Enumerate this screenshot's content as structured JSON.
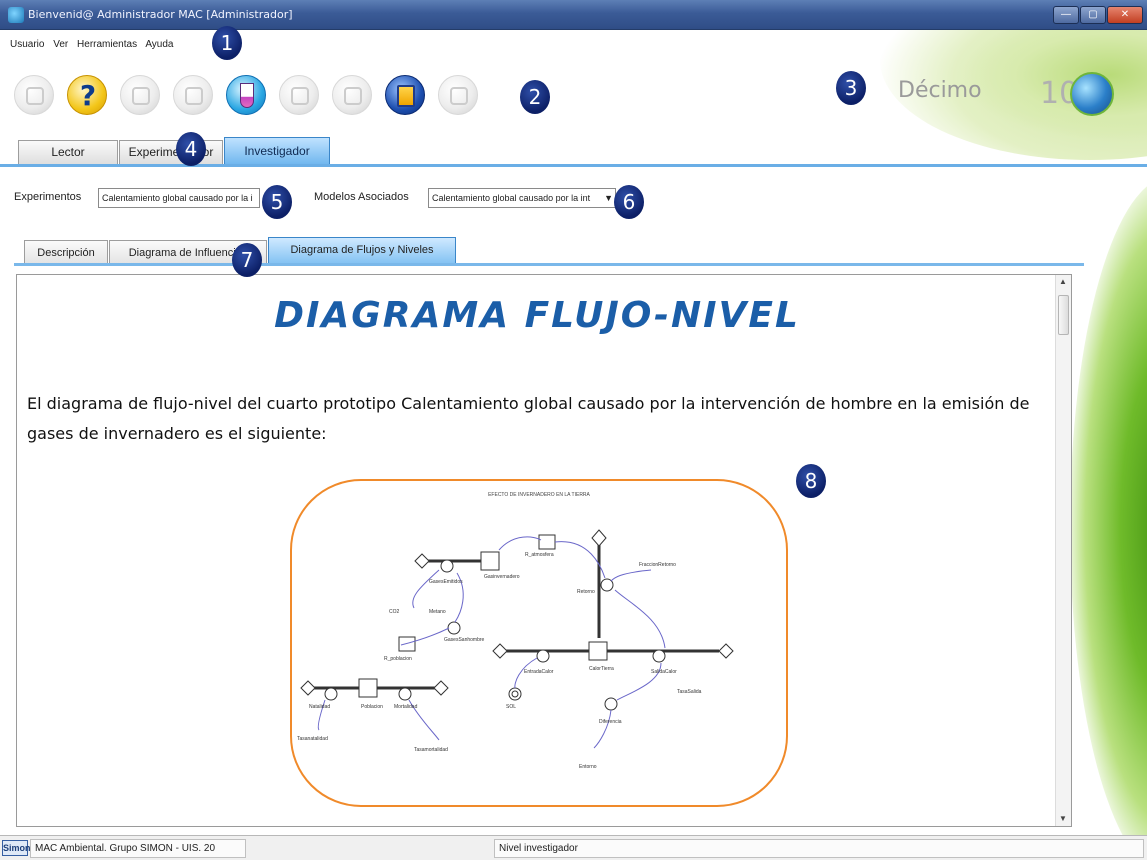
{
  "window": {
    "title": "Bienvenid@ Administrador MAC [Administrador]"
  },
  "menu": [
    "Usuario",
    "Ver",
    "Herramientas",
    "Ayuda"
  ],
  "toolbar": {
    "icons": [
      "document-icon",
      "help-icon",
      "book-icon",
      "user-icon",
      "lab-flask-icon",
      "camera-icon",
      "clapperboard-icon",
      "notebook-icon",
      "search-icon"
    ]
  },
  "level": {
    "label": "Décimo",
    "logo_text": "10"
  },
  "main_tabs": [
    "Lector",
    "Experimentador",
    "Investigador"
  ],
  "selectors": {
    "experimentos_label": "Experimentos",
    "experimentos_value": "Calentamiento global causado por la i",
    "modelos_label": "Modelos Asociados",
    "modelos_value": "Calentamiento global causado por la int"
  },
  "sub_tabs": [
    "Descripción",
    "Diagrama de Influencias",
    "Diagrama de Flujos y Niveles"
  ],
  "document": {
    "title": "DIAGRAMA FLUJO-NIVEL",
    "paragraph": "El diagrama de flujo-nivel del cuarto prototipo Calentamiento global causado por la intervención de hombre en la emisión de gases de invernadero es el siguiente:",
    "diagram": {
      "title": "EFECTO DE INVERNADERO EN LA TIERRA",
      "labels": [
        "Gasinvernadero",
        "GasesEmitidos",
        "CO2",
        "Metano",
        "R_atmosfera",
        "Retorno",
        "FraccionRetorno",
        "R_poblacion",
        "GasesSanhombre",
        "EntradaCalor",
        "CalorTierra",
        "SalidaCalor",
        "TasaSalida",
        "SOL",
        "Diferencia",
        "Entorno",
        "Poblacion",
        "Natalidad",
        "Mortalidad",
        "Tasanatalidad",
        "Tasamortalidad"
      ]
    }
  },
  "markers": [
    "1",
    "2",
    "3",
    "4",
    "5",
    "6",
    "7",
    "8"
  ],
  "status": {
    "logo": "Simon",
    "left": "MAC Ambiental. Grupo SIMON - UIS. 20",
    "right": "Nivel investigador"
  }
}
